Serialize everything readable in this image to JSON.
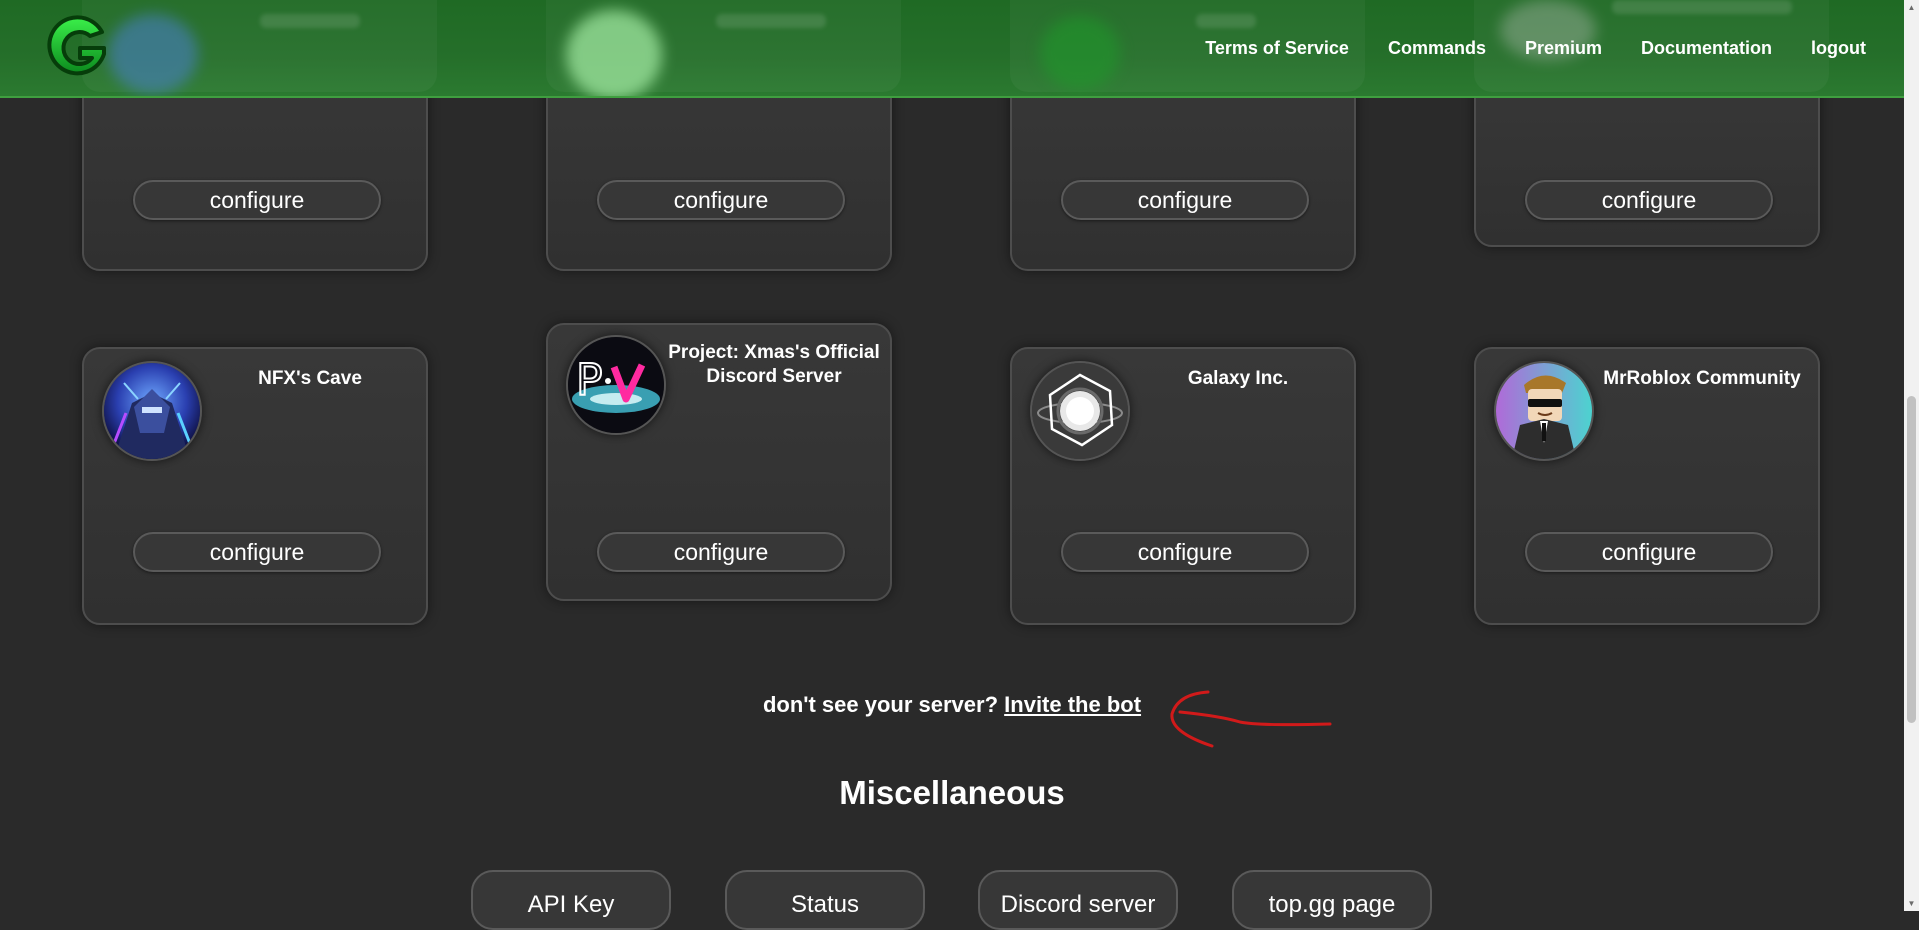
{
  "header": {
    "nav": [
      "Terms of Service",
      "Commands",
      "Premium",
      "Documentation",
      "logout"
    ]
  },
  "servers_row_top": {
    "configure_label": "configure"
  },
  "servers_row_bottom": [
    {
      "name": "NFX's Cave",
      "configure_label": "configure"
    },
    {
      "name": "Project: Xmas's Official Discord Server",
      "configure_label": "configure"
    },
    {
      "name": "Galaxy Inc.",
      "configure_label": "configure"
    },
    {
      "name": "MrRoblox Community",
      "configure_label": "configure"
    }
  ],
  "invite": {
    "prompt": "don't see your server?",
    "link": "Invite the bot"
  },
  "misc": {
    "title": "Miscellaneous",
    "buttons": [
      "API Key",
      "Status",
      "Discord server",
      "top.gg page"
    ]
  },
  "icons": {
    "logo": "g-logo-icon",
    "annotation": "red-arrow-annotation"
  },
  "colors": {
    "background": "#2a2a2a",
    "header": "#256f2a",
    "card": "#353535",
    "annotation": "#d11a1a"
  }
}
